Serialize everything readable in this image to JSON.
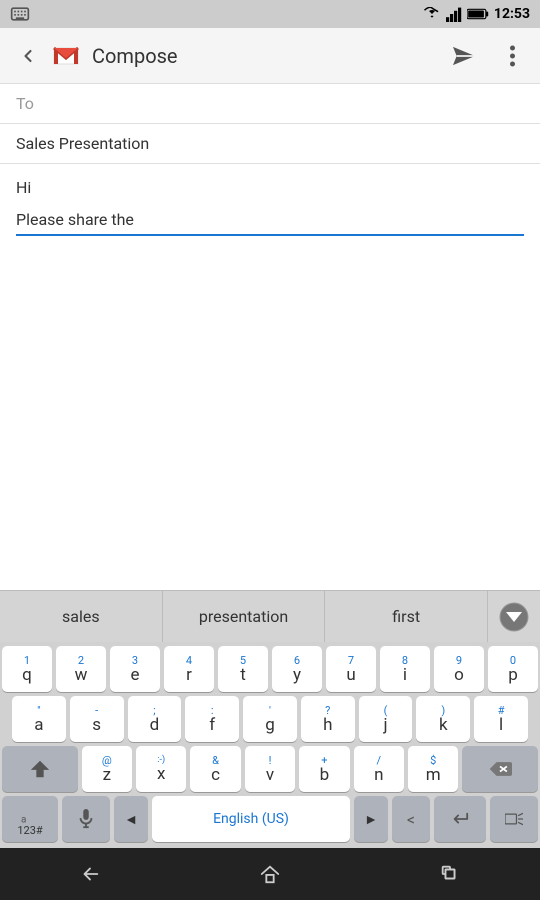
{
  "statusBar": {
    "time": "12:53",
    "keyboard_icon": "keyboard-icon",
    "wifi_icon": "wifi-icon",
    "signal_icon": "signal-icon",
    "battery_icon": "battery-icon"
  },
  "appBar": {
    "back_label": "back",
    "title": "Compose",
    "send_label": "send",
    "more_label": "more options"
  },
  "compose": {
    "to_placeholder": "To",
    "subject_value": "Sales Presentation",
    "body_line1": "Hi",
    "body_line2": "Please share the"
  },
  "autocomplete": {
    "item1": "sales",
    "item2": "presentation",
    "item3": "first",
    "arrow_label": "collapse suggestions"
  },
  "keyboard": {
    "rows": [
      {
        "keys": [
          {
            "num": "1",
            "char": "q"
          },
          {
            "num": "2",
            "char": "w"
          },
          {
            "num": "3",
            "char": "e"
          },
          {
            "num": "4",
            "char": "r"
          },
          {
            "num": "5",
            "char": "t"
          },
          {
            "num": "6",
            "char": "y"
          },
          {
            "num": "7",
            "char": "u"
          },
          {
            "num": "8",
            "char": "i"
          },
          {
            "num": "9",
            "char": "o"
          },
          {
            "num": "0",
            "char": "p"
          }
        ]
      },
      {
        "keys": [
          {
            "num": "\"",
            "char": "a"
          },
          {
            "num": "-",
            "char": "s"
          },
          {
            "num": ";",
            "char": "d"
          },
          {
            "num": ":",
            "char": "f"
          },
          {
            "num": "'",
            "char": "g"
          },
          {
            "num": "?",
            "char": "h"
          },
          {
            "num": "(",
            "char": "j"
          },
          {
            "num": ")",
            "char": "k"
          },
          {
            "num": "#",
            "char": "l"
          }
        ]
      }
    ],
    "row3": {
      "shift": "⇧",
      "keys": [
        {
          "num": "@",
          "char": "z"
        },
        {
          "num": ":-)",
          "char": "x"
        },
        {
          "num": "&",
          "char": "c"
        },
        {
          "num": "!",
          "char": "v"
        },
        {
          "num": "+",
          "char": "b"
        },
        {
          "num": "/",
          "char": "n"
        },
        {
          "num": "$",
          "char": "m"
        }
      ],
      "backspace": "⌫"
    },
    "row4": {
      "mode_label": "123#",
      "mic_label": "mic",
      "left_arrow": "◄",
      "space_label": "English (US)",
      "right_arrow": "►",
      "dot_label": ".",
      "comma_label": ",",
      "less_than": "<",
      "enter_label": "↵",
      "emoji_label": "emoji"
    }
  },
  "bottomNav": {
    "back_label": "back",
    "home_label": "home",
    "recents_label": "recents"
  }
}
